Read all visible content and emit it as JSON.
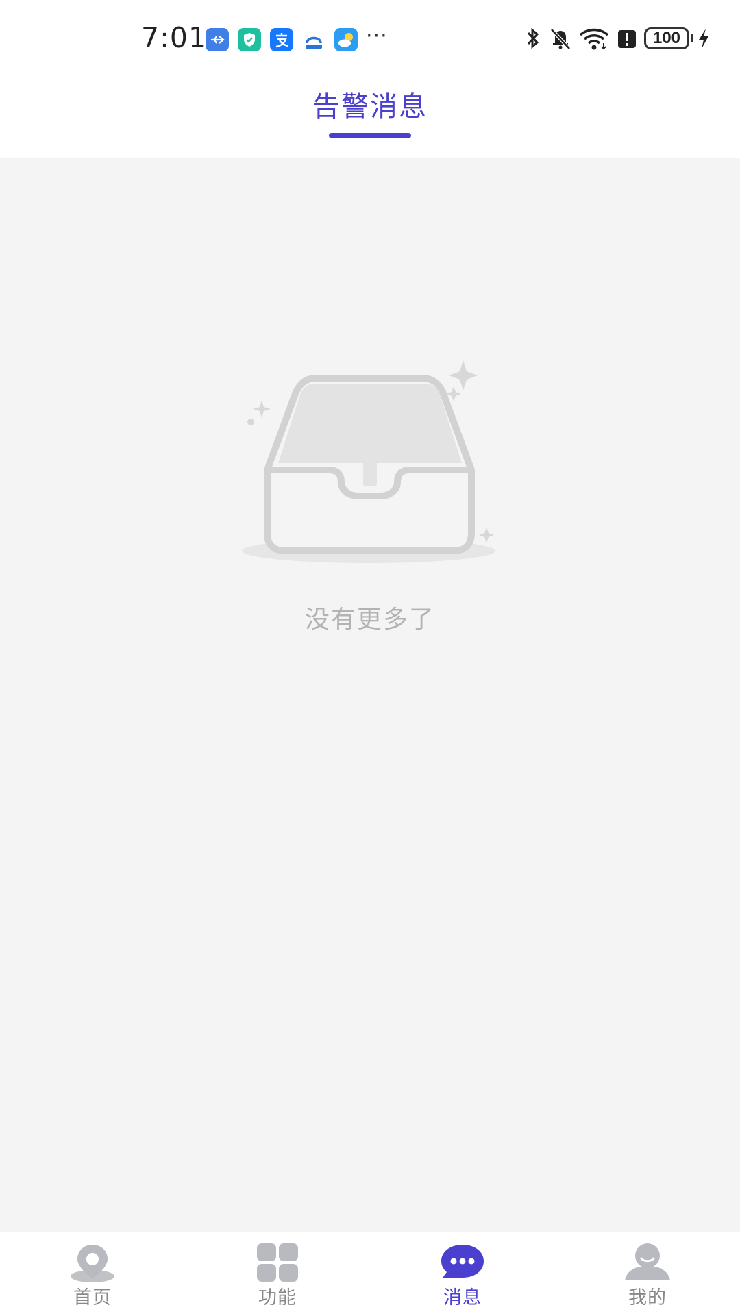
{
  "status_bar": {
    "time": "7:01",
    "more": "···",
    "battery": "100",
    "notification_icons": [
      "usb-icon",
      "shield-app-icon",
      "alipay-icon",
      "bank-app-icon",
      "weather-icon"
    ],
    "system_icons": [
      "bluetooth-icon",
      "mute-bell-icon",
      "wifi-icon",
      "alert-icon",
      "battery-icon",
      "charging-icon"
    ]
  },
  "header": {
    "title": "告警消息"
  },
  "empty_state": {
    "text": "没有更多了",
    "icon": "empty-inbox-icon"
  },
  "tabbar": {
    "active_index": 2,
    "tabs": [
      {
        "label": "首页",
        "icon": "location-pin-icon"
      },
      {
        "label": "功能",
        "icon": "grid-icon"
      },
      {
        "label": "消息",
        "icon": "chat-bubble-icon"
      },
      {
        "label": "我的",
        "icon": "user-icon"
      }
    ]
  },
  "colors": {
    "accent": "#4a3fcf",
    "inactive": "#888888",
    "background": "#f4f4f5",
    "empty_text": "#b3b3b3"
  }
}
